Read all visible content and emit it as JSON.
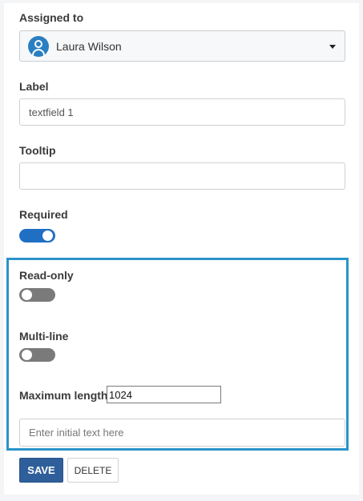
{
  "assigned": {
    "label": "Assigned to",
    "user_name": "Laura Wilson"
  },
  "label_field": {
    "label": "Label",
    "value": "textfield 1"
  },
  "tooltip_field": {
    "label": "Tooltip",
    "value": ""
  },
  "required": {
    "label": "Required",
    "on": true
  },
  "readonly": {
    "label": "Read-only",
    "on": false
  },
  "multiline": {
    "label": "Multi-line",
    "on": false
  },
  "max_length": {
    "label": "Maximum length",
    "value": "1024"
  },
  "initial_text": {
    "placeholder": "Enter initial text here"
  },
  "buttons": {
    "save": "SAVE",
    "delete": "DELETE"
  },
  "colors": {
    "accent": "#1f6fc5",
    "highlight_border": "#2a93c9",
    "save_bg": "#2f5f9a"
  }
}
